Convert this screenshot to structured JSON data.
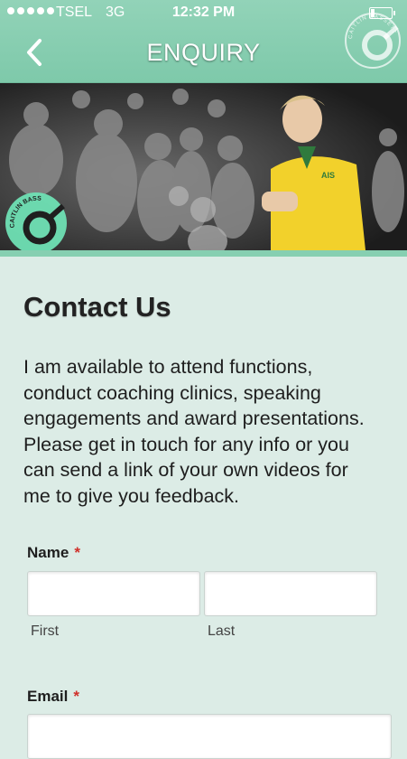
{
  "status_bar": {
    "carrier": "TSEL",
    "network": "3G",
    "time": "12:32 PM",
    "signal_bars_filled": 5
  },
  "header": {
    "title": "ENQUIRY",
    "back_icon": "chevron-left-icon",
    "logo_text": "CAITLIN BASSETT"
  },
  "hero": {
    "badge_text": "CAITLIN BASSETT",
    "jersey_text": "AIS"
  },
  "contact": {
    "heading": "Contact Us",
    "intro_lines": [
      "I am available to attend functions,",
      "conduct coaching clinics, speaking",
      "engagements and award presentations.",
      "Please get in touch for any info or you",
      "can send a link of your own videos for",
      "me to give you feedback."
    ]
  },
  "form": {
    "name": {
      "label": "Name",
      "required_mark": "*",
      "first_value": "",
      "last_value": "",
      "first_sublabel": "First",
      "last_sublabel": "Last"
    },
    "email": {
      "label": "Email",
      "required_mark": "*",
      "value": ""
    }
  },
  "colors": {
    "accent": "#86cfb1",
    "background": "#dcece6",
    "required": "#d0302a"
  }
}
